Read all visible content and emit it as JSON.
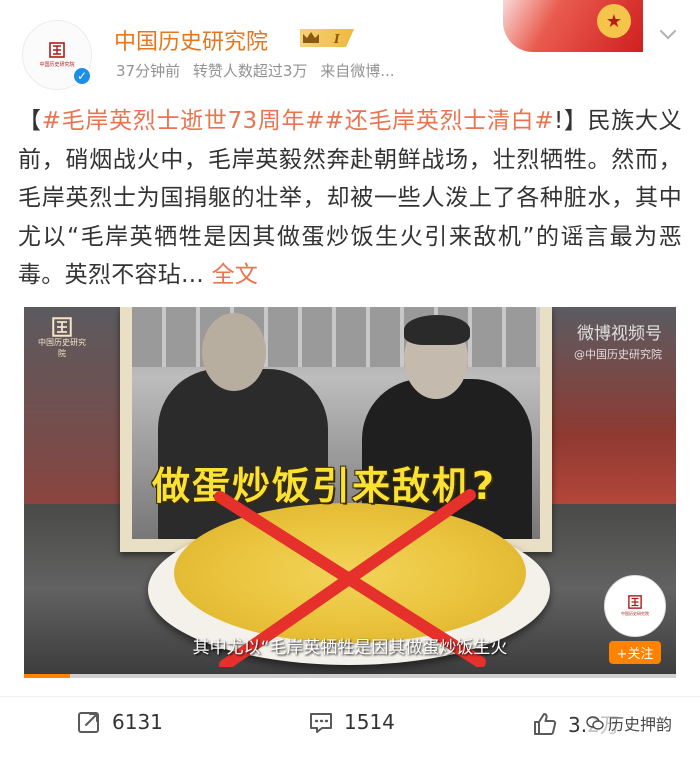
{
  "header": {
    "user_name": "中国历史研究院",
    "level": "I",
    "avatar_text": "中国历史研究院",
    "meta": {
      "time": "37分钟前",
      "reposts_note": "转赞人数超过3万",
      "source": "来自微博..."
    }
  },
  "post": {
    "open_bracket": "【",
    "topic1": "#毛岸英烈士逝世73周年#",
    "topic2": "#还毛岸英烈士清白#",
    "text": "!】民族大义前，硝烟战火中，毛岸英毅然奔赴朝鲜战场，壮烈牺牲。然而，毛岸英烈士为国捐躯的壮举，却被一些人泼上了各种脏水，其中尤以“毛岸英牺牲是因其做蛋炒饭生火引来敌机”的谣言最为恶毒。英烈不容玷",
    "ellipsis": "...",
    "more_link": "全文"
  },
  "media": {
    "headline": "做蛋炒饭引来敌机?",
    "subtitle": "其中尤以“毛岸英牺牲是因其做蛋炒饭生火",
    "watermark_title": "微博视频号",
    "watermark_sub": "@中国历史研究院",
    "logo_text": "中国历史研究院",
    "follow_label": "+关注",
    "progress": 0.07
  },
  "footer": {
    "repost_count": "6131",
    "comment_count": "1514",
    "like_count": "3.2万",
    "watermark": "历史押韵"
  },
  "colors": {
    "brand_orange": "#ff8200",
    "username_orange": "#e8761c",
    "topic_link": "#eb7350",
    "verified_blue": "#1b8fe8"
  }
}
